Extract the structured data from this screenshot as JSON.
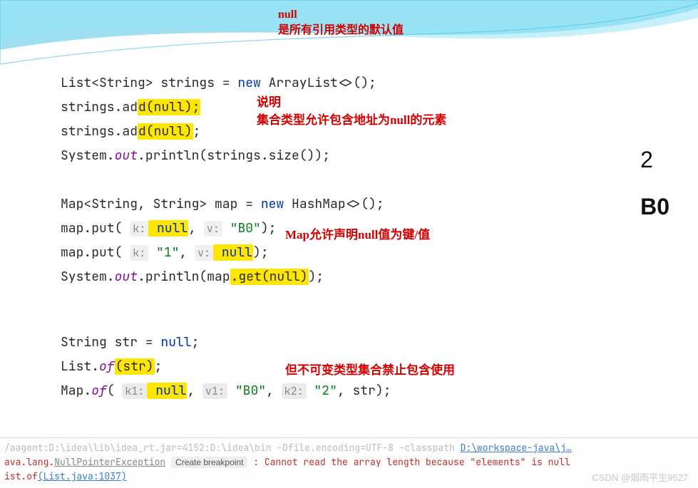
{
  "header": {
    "line1": "null",
    "line2": "是所有引用类型的默认值"
  },
  "code": {
    "l1_pre": "List<String> strings = ",
    "l1_new": "new",
    "l1_post": " ArrayList<>();",
    "l2_pre": "strings.ad",
    "l2_hl": "d(null);",
    "l3_pre": "strings.ad",
    "l3_hl": "d(null)",
    "l3_post": ";",
    "l4_pre": "System.",
    "l4_out": "out",
    "l4_post": ".println(strings.size());",
    "l5_pre": "Map<String, String> map = ",
    "l5_new": "new",
    "l5_post": " HashMap<>();",
    "l6_pre": "map.put( ",
    "l6_hintk": "k:",
    "l6_null": " null",
    "l6_mid": ",  ",
    "l6_hintv": "v:",
    "l6_val": " \"B0\"",
    "l6_end": ");",
    "l7_pre": "map.put( ",
    "l7_hintk": "k:",
    "l7_kval": " \"1\"",
    "l7_mid": ",  ",
    "l7_hintv": "v:",
    "l7_null": " null",
    "l7_end": ");",
    "l8_pre": "System.",
    "l8_out": "out",
    "l8_mid": ".println(map",
    "l8_hl": ".get(null)",
    "l8_end": ");",
    "l9_pre": "String str = ",
    "l9_null": "null",
    "l9_end": ";",
    "l10_pre": "List.",
    "l10_of": "of",
    "l10_hl": "(str)",
    "l10_end": ";",
    "l11_pre": "Map.",
    "l11_of": "of",
    "l11_open": "( ",
    "l11_k1": "k1:",
    "l11_k1v": " null",
    "l11_c1": ",  ",
    "l11_v1": "v1:",
    "l11_v1v": " \"B0\"",
    "l11_c2": ",  ",
    "l11_k2": "k2:",
    "l11_k2v": " \"2\"",
    "l11_c3": ", str);"
  },
  "notes": {
    "n1a": "说明",
    "n1b": "集合类型允许包含地址为null的元素",
    "n2": "Map允许声明null值为键/值",
    "n3": "但不可变类型集合禁止包含使用"
  },
  "output": {
    "o1": "2",
    "o2": "B0"
  },
  "console": {
    "faded_line": "/aagent:D:\\idea\\lib\\idea_rt.jar=4152:D:\\idea\\bin -Dfile.encoding=UTF-8 -classpath ",
    "faded_link": "D:\\workspace-java\\j…",
    "err_pkg": "ava.lang.",
    "err_class": "NullPointerException",
    "bp_label": "Create breakpoint",
    "err_msg": " : Cannot read the array length because \"elements\" is null",
    "trace": "ist.of",
    "trace_loc": "(List.java:1037)"
  },
  "watermark": "CSDN @烟雨平生9527"
}
